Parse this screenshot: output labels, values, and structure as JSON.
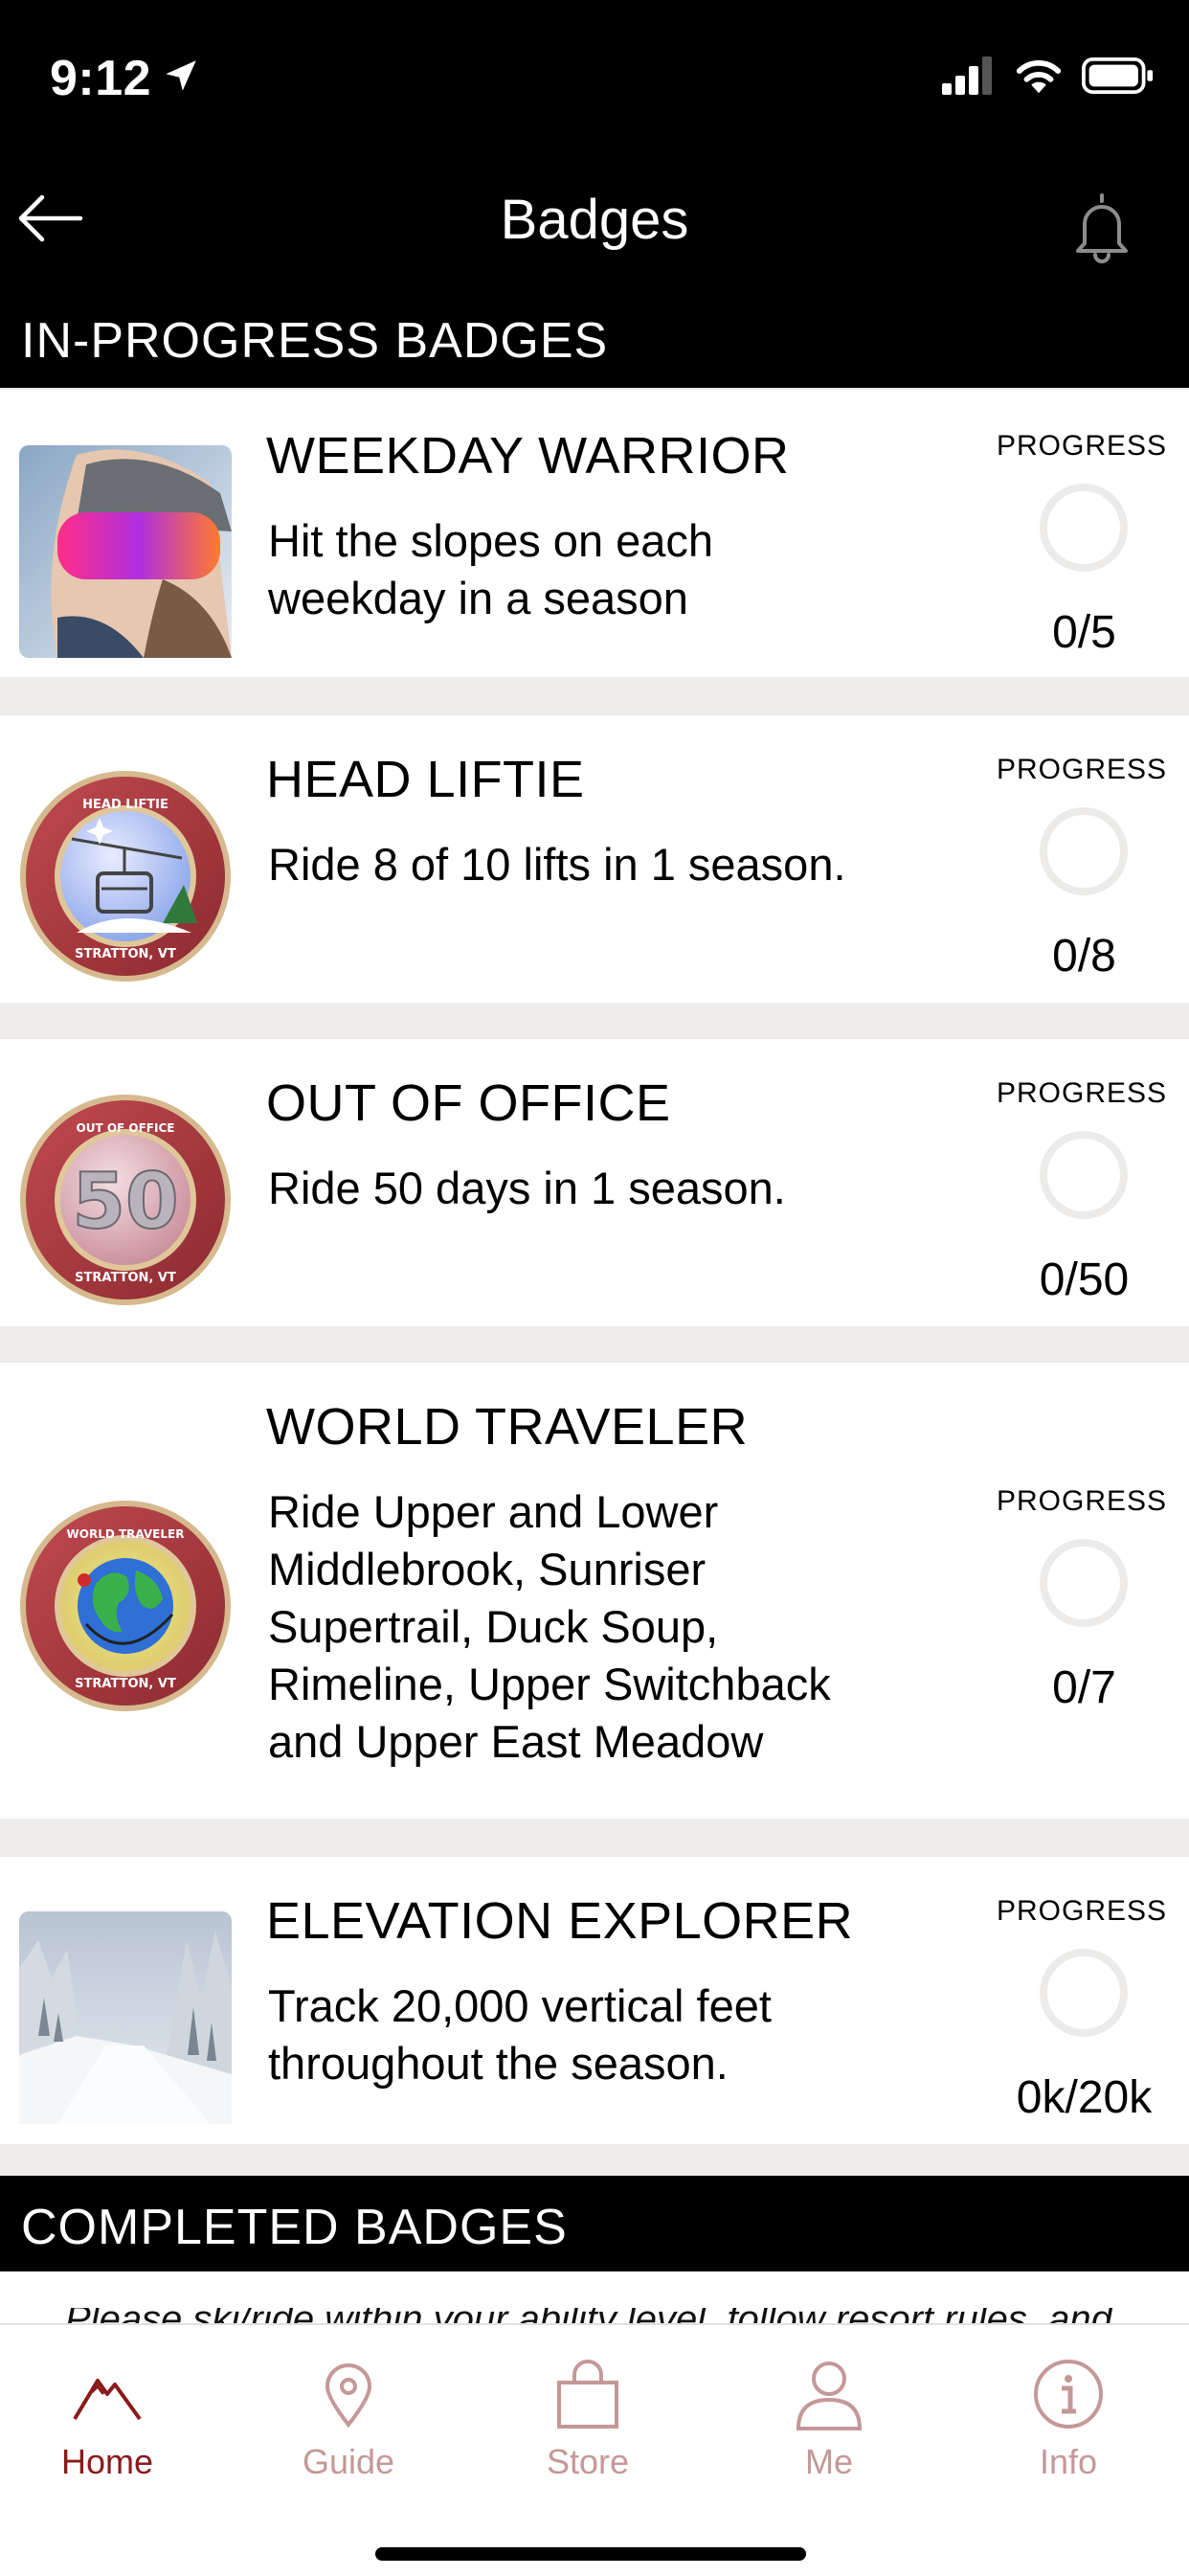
{
  "status_bar": {
    "time": "9:12"
  },
  "header": {
    "title": "Badges"
  },
  "sections": {
    "in_progress": "IN-PROGRESS BADGES",
    "completed": "COMPLETED BADGES"
  },
  "badges": [
    {
      "title": "WEEKDAY WARRIOR",
      "desc_lines": [
        "Hit the slopes on each",
        "weekday in a season"
      ],
      "progress_label": "PROGRESS",
      "progress": "0/5",
      "fraction": 0
    },
    {
      "title": "HEAD LIFTIE",
      "desc_lines": [
        "Ride 8 of 10 lifts in 1 season."
      ],
      "progress_label": "PROGRESS",
      "progress": "0/8",
      "fraction": 0,
      "emblem": {
        "top": "HEAD LIFTIE",
        "bottom": "STRATTON, VT"
      }
    },
    {
      "title": "OUT OF OFFICE",
      "desc_lines": [
        "Ride 50 days in 1 season."
      ],
      "progress_label": "PROGRESS",
      "progress": "0/50",
      "fraction": 0,
      "emblem": {
        "top": "OUT OF OFFICE",
        "center": "50",
        "bottom": "STRATTON, VT"
      }
    },
    {
      "title": "WORLD TRAVELER",
      "desc_lines": [
        "Ride Upper and Lower",
        "Middlebrook, Sunriser",
        "Supertrail, Duck Soup,",
        "Rimeline, Upper Switchback",
        "and Upper East Meadow"
      ],
      "progress_label": "PROGRESS",
      "progress": "0/7",
      "fraction": 0,
      "emblem": {
        "top": "WORLD TRAVELER",
        "bottom": "STRATTON, VT"
      }
    },
    {
      "title": "ELEVATION EXPLORER",
      "desc_lines": [
        "Track 20,000 vertical feet",
        "throughout the season."
      ],
      "progress_label": "PROGRESS",
      "progress": "0k/20k",
      "fraction": 0
    }
  ],
  "disclaimer": "Please ski/ride within your ability level, follow resort rules, and",
  "tabs": [
    {
      "label": "Home",
      "icon": "mountain-icon",
      "active": true
    },
    {
      "label": "Guide",
      "icon": "map-pin-icon",
      "active": false
    },
    {
      "label": "Store",
      "icon": "shopping-bag-icon",
      "active": false
    },
    {
      "label": "Me",
      "icon": "person-icon",
      "active": false
    },
    {
      "label": "Info",
      "icon": "info-icon",
      "active": false
    }
  ],
  "colors": {
    "accent": "#8b1a1a",
    "inactive_tab": "#c59898",
    "badge_rim": "#a8343a",
    "ring_track": "#ecebea"
  }
}
